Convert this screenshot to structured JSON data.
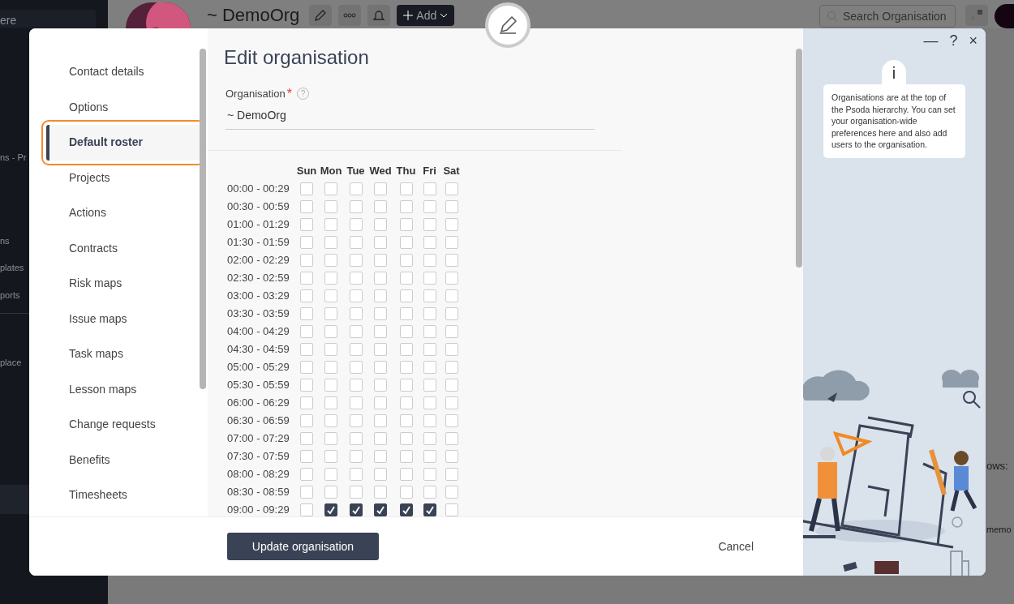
{
  "background": {
    "sidebar_search": "ere",
    "sidebar_items": [
      "ns - Pr",
      "ns",
      "plates",
      "ports",
      "place"
    ],
    "org_name": "~ DemoOrg",
    "add_button": "Add",
    "search_placeholder": "Search Organisation",
    "fragments": [
      "ows:",
      "memo"
    ]
  },
  "nav": {
    "items": [
      {
        "label": "Contact details",
        "selected": false
      },
      {
        "label": "Options",
        "selected": false
      },
      {
        "label": "Default roster",
        "selected": true
      },
      {
        "label": "Projects",
        "selected": false
      },
      {
        "label": "Actions",
        "selected": false
      },
      {
        "label": "Contracts",
        "selected": false
      },
      {
        "label": "Risk maps",
        "selected": false
      },
      {
        "label": "Issue maps",
        "selected": false
      },
      {
        "label": "Task maps",
        "selected": false
      },
      {
        "label": "Lesson maps",
        "selected": false
      },
      {
        "label": "Change requests",
        "selected": false
      },
      {
        "label": "Benefits",
        "selected": false
      },
      {
        "label": "Timesheets",
        "selected": false
      }
    ]
  },
  "form": {
    "title": "Edit organisation",
    "field": {
      "label": "Organisation",
      "required_mark": "*",
      "help": "?",
      "value": "~ DemoOrg"
    }
  },
  "roster": {
    "days": [
      "Sun",
      "Mon",
      "Tue",
      "Wed",
      "Thu",
      "Fri",
      "Sat"
    ],
    "rows": [
      {
        "label": "00:00 - 00:29",
        "checks": [
          false,
          false,
          false,
          false,
          false,
          false,
          false
        ]
      },
      {
        "label": "00:30 - 00:59",
        "checks": [
          false,
          false,
          false,
          false,
          false,
          false,
          false
        ]
      },
      {
        "label": "01:00 - 01:29",
        "checks": [
          false,
          false,
          false,
          false,
          false,
          false,
          false
        ]
      },
      {
        "label": "01:30 - 01:59",
        "checks": [
          false,
          false,
          false,
          false,
          false,
          false,
          false
        ]
      },
      {
        "label": "02:00 - 02:29",
        "checks": [
          false,
          false,
          false,
          false,
          false,
          false,
          false
        ]
      },
      {
        "label": "02:30 - 02:59",
        "checks": [
          false,
          false,
          false,
          false,
          false,
          false,
          false
        ]
      },
      {
        "label": "03:00 - 03:29",
        "checks": [
          false,
          false,
          false,
          false,
          false,
          false,
          false
        ]
      },
      {
        "label": "03:30 - 03:59",
        "checks": [
          false,
          false,
          false,
          false,
          false,
          false,
          false
        ]
      },
      {
        "label": "04:00 - 04:29",
        "checks": [
          false,
          false,
          false,
          false,
          false,
          false,
          false
        ]
      },
      {
        "label": "04:30 - 04:59",
        "checks": [
          false,
          false,
          false,
          false,
          false,
          false,
          false
        ]
      },
      {
        "label": "05:00 - 05:29",
        "checks": [
          false,
          false,
          false,
          false,
          false,
          false,
          false
        ]
      },
      {
        "label": "05:30 - 05:59",
        "checks": [
          false,
          false,
          false,
          false,
          false,
          false,
          false
        ]
      },
      {
        "label": "06:00 - 06:29",
        "checks": [
          false,
          false,
          false,
          false,
          false,
          false,
          false
        ]
      },
      {
        "label": "06:30 - 06:59",
        "checks": [
          false,
          false,
          false,
          false,
          false,
          false,
          false
        ]
      },
      {
        "label": "07:00 - 07:29",
        "checks": [
          false,
          false,
          false,
          false,
          false,
          false,
          false
        ]
      },
      {
        "label": "07:30 - 07:59",
        "checks": [
          false,
          false,
          false,
          false,
          false,
          false,
          false
        ]
      },
      {
        "label": "08:00 - 08:29",
        "checks": [
          false,
          false,
          false,
          false,
          false,
          false,
          false
        ]
      },
      {
        "label": "08:30 - 08:59",
        "checks": [
          false,
          false,
          false,
          false,
          false,
          false,
          false
        ]
      },
      {
        "label": "09:00 - 09:29",
        "checks": [
          false,
          true,
          true,
          true,
          true,
          true,
          false
        ]
      }
    ]
  },
  "footer": {
    "submit": "Update organisation",
    "cancel": "Cancel"
  },
  "window_controls": [
    "—",
    "?",
    "×"
  ],
  "info": {
    "tab": "i",
    "text": "Organisations are at the top of the Psoda hierarchy. You can set your organisation-wide preferences here and also add users to the organisation."
  }
}
